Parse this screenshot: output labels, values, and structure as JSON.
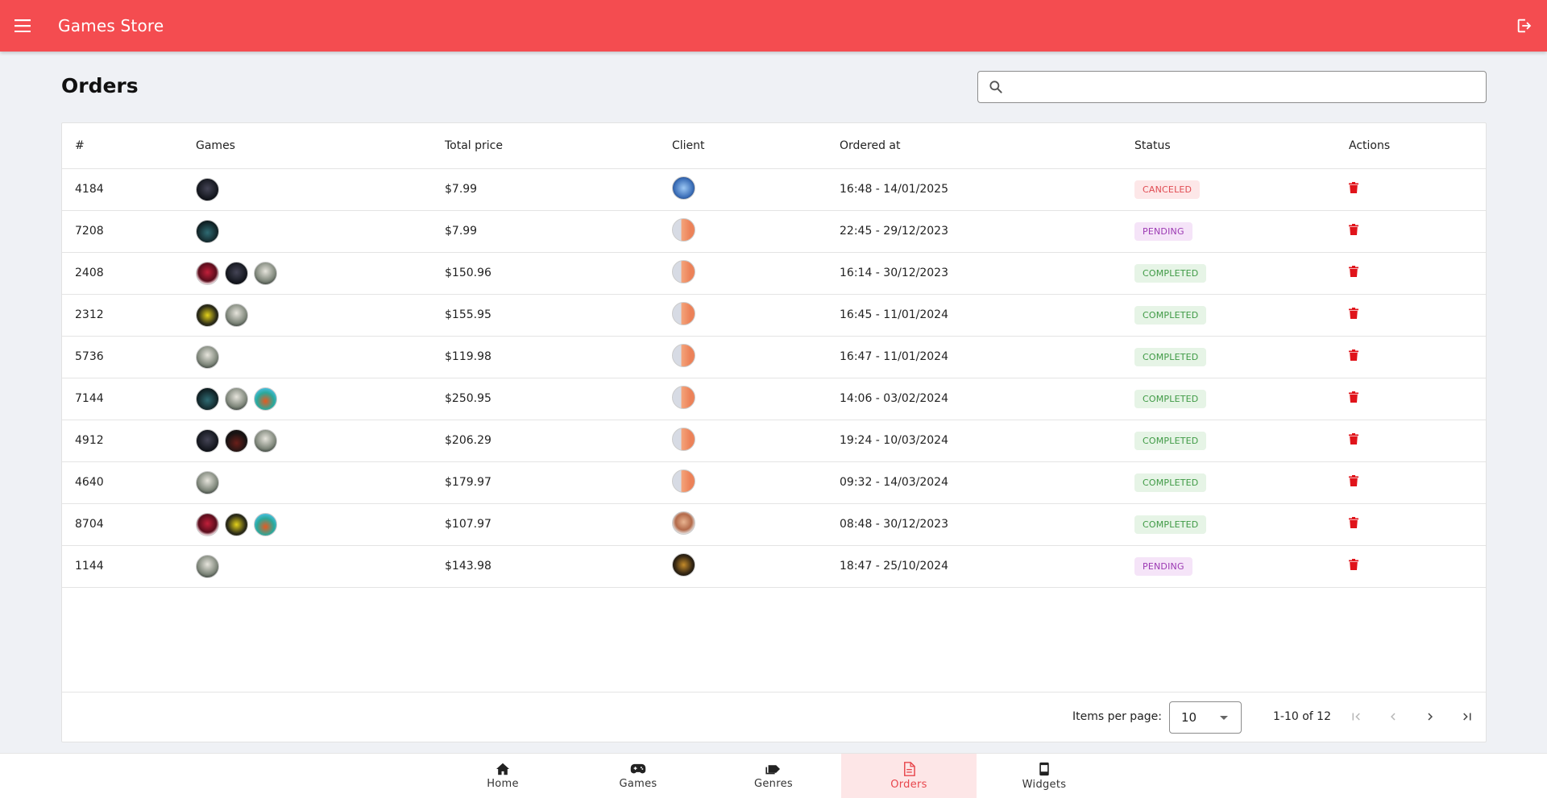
{
  "header": {
    "menu_icon": "menu-icon",
    "title": "Games Store",
    "logout_icon": "logout-icon"
  },
  "page": {
    "title": "Orders",
    "search": {
      "value": "",
      "placeholder": "",
      "icon": "search-icon"
    }
  },
  "table": {
    "columns": [
      "#",
      "Games",
      "Total price",
      "Client",
      "Ordered at",
      "Status",
      "Actions"
    ],
    "rows": [
      {
        "id": "4184",
        "games": [
          "alan-wake",
          ""
        ],
        "price": "$7.99",
        "client": "blue",
        "ordered_at": "16:48 - 14/01/2025",
        "status": "CANCELED"
      },
      {
        "id": "7208",
        "games": [
          "dark"
        ],
        "price": "$7.99",
        "client": "fox",
        "ordered_at": "22:45 - 29/12/2023",
        "status": "PENDING"
      },
      {
        "id": "2408",
        "games": [
          "red",
          "alan-wake",
          "grey"
        ],
        "price": "$150.96",
        "client": "fox",
        "ordered_at": "16:14 - 30/12/2023",
        "status": "COMPLETED"
      },
      {
        "id": "2312",
        "games": [
          "yellow",
          "grey"
        ],
        "price": "$155.95",
        "client": "fox",
        "ordered_at": "16:45 - 11/01/2024",
        "status": "COMPLETED"
      },
      {
        "id": "5736",
        "games": [
          "grey"
        ],
        "price": "$119.98",
        "client": "fox",
        "ordered_at": "16:47 - 11/01/2024",
        "status": "COMPLETED"
      },
      {
        "id": "7144",
        "games": [
          "dark",
          "grey",
          "car"
        ],
        "price": "$250.95",
        "client": "fox",
        "ordered_at": "14:06 - 03/02/2024",
        "status": "COMPLETED"
      },
      {
        "id": "4912",
        "games": [
          "alan-wake",
          "dw",
          "grey"
        ],
        "price": "$206.29",
        "client": "fox",
        "ordered_at": "19:24 - 10/03/2024",
        "status": "COMPLETED"
      },
      {
        "id": "4640",
        "games": [
          "grey"
        ],
        "price": "$179.97",
        "client": "fox",
        "ordered_at": "09:32 - 14/03/2024",
        "status": "COMPLETED"
      },
      {
        "id": "8704",
        "games": [
          "red",
          "yellow",
          "car"
        ],
        "price": "$107.97",
        "client": "man",
        "ordered_at": "08:48 - 30/12/2023",
        "status": "COMPLETED"
      },
      {
        "id": "1144",
        "games": [
          "grey"
        ],
        "price": "$143.98",
        "client": "dark",
        "ordered_at": "18:47 - 25/10/2024",
        "status": "PENDING"
      }
    ],
    "delete_icon": "trash-icon"
  },
  "paginator": {
    "items_per_page_label": "Items per page:",
    "items_per_page_value": "10",
    "range_label": "1-10 of 12",
    "icons": [
      "first-page-icon",
      "previous-page-icon",
      "next-page-icon",
      "last-page-icon"
    ]
  },
  "bottom_nav": {
    "items": [
      {
        "label": "Home",
        "icon": "home-icon",
        "active": false
      },
      {
        "label": "Games",
        "icon": "gamepad-icon",
        "active": false
      },
      {
        "label": "Genres",
        "icon": "label-icon",
        "active": false
      },
      {
        "label": "Orders",
        "icon": "document-icon",
        "active": true
      },
      {
        "label": "Widgets",
        "icon": "widget-icon",
        "active": false
      }
    ]
  },
  "colors": {
    "brand": "#f44c50",
    "canceled": "#e04b52",
    "pending": "#9c3ab3",
    "completed": "#3f9a45",
    "delete": "#e0141b"
  }
}
